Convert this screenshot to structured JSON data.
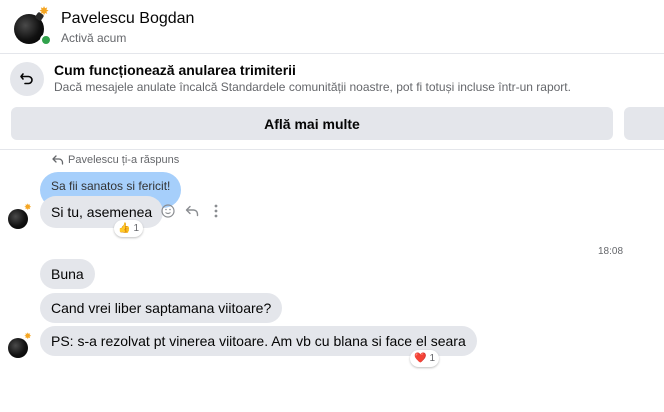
{
  "header": {
    "contact_name": "Pavelescu Bogdan",
    "status": "Activă acum",
    "online_color": "#31a24c"
  },
  "notice": {
    "icon": "undo-icon",
    "title": "Cum funcționează anularea trimiterii",
    "description": "Dacă mesajele anulate încalcă Standardele comunității noastre, pot fi totuși incluse într-un raport.",
    "button_label": "Află mai multe"
  },
  "conversation": {
    "reply_hint": "Pavelescu ți-a răspuns",
    "quoted_message": "Sa fii sanatos si fericit!",
    "reply_message": "Si tu, asemenea",
    "reply_reaction": {
      "emoji": "👍",
      "count": "1"
    },
    "timestamp": "18:08",
    "messages": [
      {
        "text": "Buna"
      },
      {
        "text": "Cand vrei liber saptamana viitoare?"
      },
      {
        "text": "PS: s-a rezolvat pt vinerea viitoare. Am vb cu blana si face el seara"
      }
    ],
    "last_reaction": {
      "emoji": "❤️",
      "count": "1"
    }
  },
  "colors": {
    "bubble_gray": "#e4e6eb",
    "quoted_blue": "#a6cffb",
    "secondary_text": "#65676b"
  }
}
